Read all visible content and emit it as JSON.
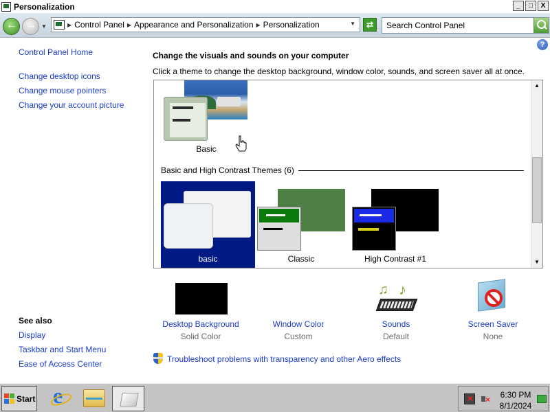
{
  "window": {
    "title": "Personalization",
    "buttons": {
      "minimize": "_",
      "maximize": "□",
      "close": "X"
    }
  },
  "addressbar": {
    "crumbs": [
      "Control Panel",
      "Appearance and Personalization",
      "Personalization"
    ],
    "search_placeholder": "Search Control Panel"
  },
  "sidebar": {
    "home": "Control Panel Home",
    "links": [
      "Change desktop icons",
      "Change mouse pointers",
      "Change your account picture"
    ],
    "see_also_title": "See also",
    "see_also": [
      "Display",
      "Taskbar and Start Menu",
      "Ease of Access Center"
    ]
  },
  "main": {
    "title": "Change the visuals and sounds on your computer",
    "description": "Click a theme to change the desktop background, window color, sounds, and screen saver all at once.",
    "themes": {
      "top_theme": "Basic",
      "section_header": "Basic and High Contrast Themes (6)",
      "items": [
        {
          "label": "basic",
          "selected": true
        },
        {
          "label": "Classic",
          "selected": false
        },
        {
          "label": "High Contrast #1",
          "selected": false
        }
      ]
    },
    "settings": [
      {
        "label": "Desktop Background",
        "value": "Solid Color"
      },
      {
        "label": "Window Color",
        "value": "Custom"
      },
      {
        "label": "Sounds",
        "value": "Default"
      },
      {
        "label": "Screen Saver",
        "value": "None"
      }
    ],
    "troubleshoot_link": "Troubleshoot problems with transparency and other Aero effects",
    "help_icon": "?"
  },
  "taskbar": {
    "start_label": "Start",
    "time": "6:30 PM",
    "date": "8/1/2024",
    "pinned": [
      "internet-explorer-icon",
      "explorer-folder-icon",
      "personalization-window-icon"
    ]
  },
  "colors": {
    "link": "#1a3ccc",
    "selected_theme_bg": "#001a85",
    "secondary_text": "#6d6d6d"
  }
}
